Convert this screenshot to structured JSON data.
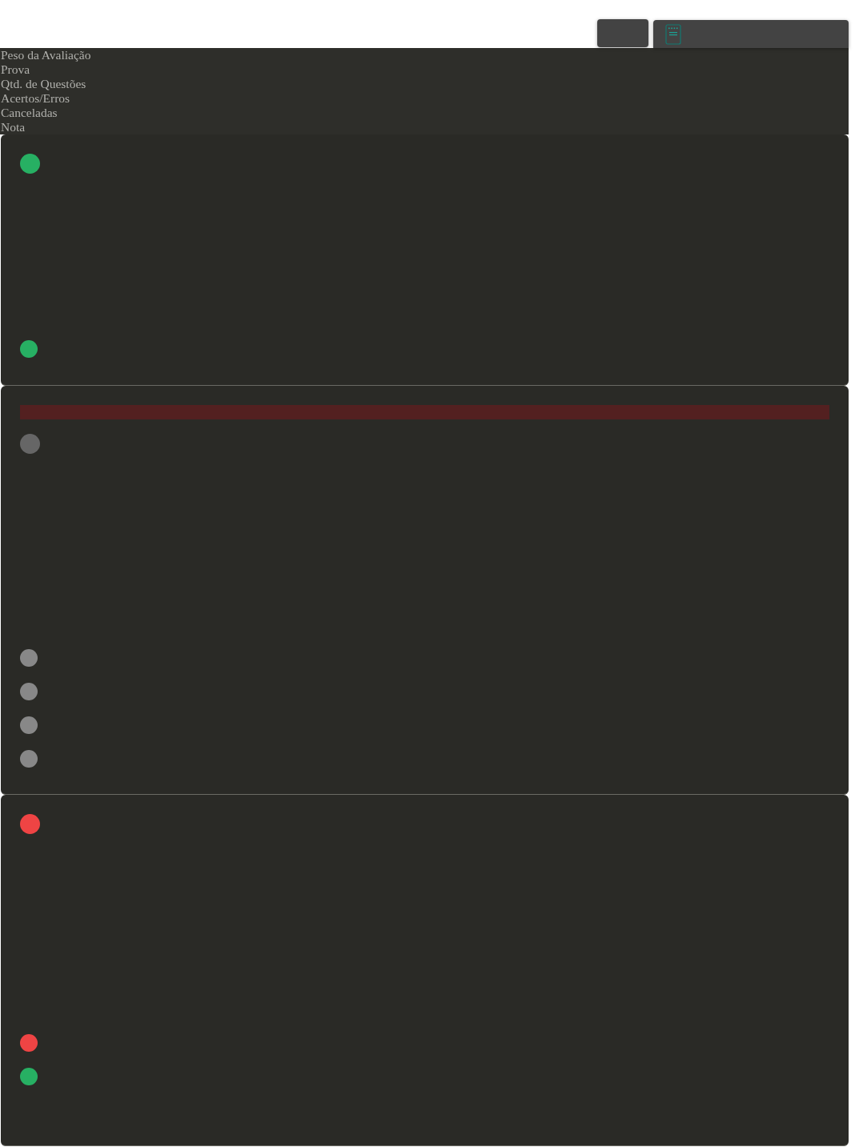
{
  "summary_labels": [
    "Peso da Avaliação",
    "Prova",
    "Qtd. de Questões",
    "Acertos/Erros",
    "Canceladas",
    "Nota"
  ],
  "cards": [
    {
      "banner": false,
      "status": {
        "color": "#27b063"
      },
      "items": [
        {
          "color": "#27b063"
        }
      ]
    },
    {
      "banner": true,
      "status": {
        "color": "#666666"
      },
      "items": [
        {
          "color": "#888888"
        },
        {
          "color": "#888888"
        },
        {
          "color": "#888888"
        },
        {
          "color": "#888888"
        }
      ]
    },
    {
      "banner": false,
      "status": {
        "color": "#ef4444"
      },
      "items": [
        {
          "color": "#ef4444"
        },
        {
          "color": "#27b063"
        }
      ]
    }
  ]
}
